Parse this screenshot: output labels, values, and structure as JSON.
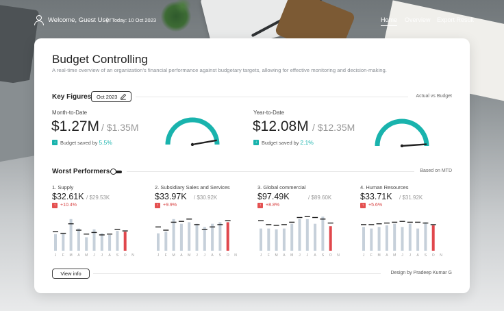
{
  "header": {
    "welcome": "Welcome, Guest User",
    "separator": "|",
    "today": "Today: 10 Oct 2023",
    "nav": {
      "home": "Home",
      "overview": "Overview",
      "export": "Export Result"
    }
  },
  "main": {
    "title": "Budget Controlling",
    "subtitle": "A real-time overview of an organization's financial performance against budgetary targets, allowing for effective monitoring and decision-making."
  },
  "key_figures": {
    "label": "Key Figures",
    "month": "Oct 2023",
    "right_note": "Actual vs Budget",
    "mtd": {
      "period": "Month-to-Date",
      "actual": "$1.27M",
      "budget": "/ $1.35M",
      "saved_text": "Budget saved by",
      "saved_pct": "5.5%"
    },
    "ytd": {
      "period": "Year-to-Date",
      "actual": "$12.08M",
      "budget": "/ $12.35M",
      "saved_text": "Budget saved by",
      "saved_pct": "2.1%"
    }
  },
  "worst": {
    "label": "Worst Performers",
    "right_note": "Based on MTD",
    "items": [
      {
        "rank": "1.",
        "name": "Supply",
        "actual": "$32.61K",
        "budget": "/ $29.53K",
        "variance": "+10.4%"
      },
      {
        "rank": "2.",
        "name": "Subsidiary Sales and Services",
        "actual": "$33.97K",
        "budget": "/ $30.92K",
        "variance": "+9.9%"
      },
      {
        "rank": "3.",
        "name": "Global commercial",
        "actual": "$97.49K",
        "budget": "/ $89.60K",
        "variance": "+8.8%"
      },
      {
        "rank": "4.",
        "name": "Human Resources",
        "actual": "$33.71K",
        "budget": "/ $31.92K",
        "variance": "+5.6%"
      }
    ]
  },
  "colors": {
    "accent": "#19b3ad",
    "bar": "#c6d0da",
    "bar_current": "#e0474c",
    "budget_mark": "#222222",
    "gauge_needle": "#222222"
  },
  "chart_data": [
    {
      "type": "bar",
      "title": "1. Supply",
      "categories": [
        "J",
        "F",
        "M",
        "A",
        "M",
        "J",
        "J",
        "A",
        "S",
        "O",
        "N",
        "D"
      ],
      "series": [
        {
          "name": "actual",
          "values": [
            21,
            21,
            40,
            28,
            17,
            27,
            22,
            20,
            25,
            24,
            null,
            null
          ]
        },
        {
          "name": "budget",
          "values": [
            24,
            22,
            34,
            26,
            21,
            23,
            20,
            21,
            27,
            25,
            null,
            null
          ]
        }
      ],
      "highlight_index": 9,
      "ylim": [
        0,
        45
      ]
    },
    {
      "type": "bar",
      "title": "2. Subsidiary Sales and Services",
      "categories": [
        "J",
        "F",
        "M",
        "A",
        "M",
        "J",
        "J",
        "A",
        "S",
        "O",
        "N",
        "D"
      ],
      "series": [
        {
          "name": "actual",
          "values": [
            22,
            24,
            40,
            34,
            36,
            34,
            30,
            34,
            36,
            36,
            null,
            null
          ]
        },
        {
          "name": "budget",
          "values": [
            30,
            26,
            36,
            37,
            40,
            33,
            27,
            30,
            33,
            38,
            null,
            null
          ]
        }
      ],
      "highlight_index": 9,
      "ylim": [
        0,
        45
      ]
    },
    {
      "type": "bar",
      "title": "3. Global commercial",
      "categories": [
        "J",
        "F",
        "M",
        "A",
        "M",
        "J",
        "J",
        "A",
        "S",
        "O",
        "N",
        "D"
      ],
      "series": [
        {
          "name": "actual",
          "values": [
            28,
            28,
            27,
            28,
            34,
            40,
            40,
            34,
            43,
            31,
            null,
            null
          ]
        },
        {
          "name": "budget",
          "values": [
            38,
            33,
            32,
            33,
            36,
            42,
            43,
            42,
            40,
            35,
            null,
            null
          ]
        }
      ],
      "highlight_index": 9,
      "ylim": [
        0,
        45
      ]
    },
    {
      "type": "bar",
      "title": "4. Human Resources",
      "categories": [
        "J",
        "F",
        "M",
        "A",
        "M",
        "J",
        "J",
        "A",
        "S",
        "O",
        "N",
        "D"
      ],
      "series": [
        {
          "name": "actual",
          "values": [
            30,
            28,
            30,
            32,
            34,
            30,
            34,
            28,
            36,
            32,
            null,
            null
          ]
        },
        {
          "name": "budget",
          "values": [
            33,
            33,
            34,
            35,
            36,
            37,
            36,
            36,
            35,
            33,
            null,
            null
          ]
        }
      ],
      "highlight_index": 9,
      "ylim": [
        0,
        45
      ]
    }
  ],
  "gauges": [
    {
      "label": "mtd",
      "ratio": 0.945
    },
    {
      "label": "ytd",
      "ratio": 0.978
    }
  ],
  "footer": {
    "view_info": "View info",
    "design_credit": "Design by Pradeep Kumar G"
  }
}
